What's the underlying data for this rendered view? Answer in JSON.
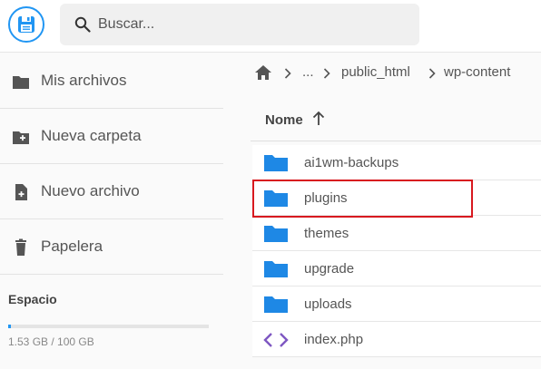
{
  "header": {
    "logo_icon": "floppy-disk-icon",
    "search_placeholder": "Buscar..."
  },
  "sidebar": {
    "items": [
      {
        "label": "Mis archivos",
        "icon": "folder-icon"
      },
      {
        "label": "Nueva carpeta",
        "icon": "folder-plus-icon"
      },
      {
        "label": "Nuevo archivo",
        "icon": "file-plus-icon"
      },
      {
        "label": "Papelera",
        "icon": "trash-icon"
      }
    ],
    "storage": {
      "title": "Espacio",
      "used_text": "1.53 GB / 100 GB",
      "used_fraction": 0.0153
    }
  },
  "breadcrumb": {
    "home_icon": "home-icon",
    "items": [
      "...",
      "public_html",
      "wp-content"
    ]
  },
  "table": {
    "column": "Nome",
    "sort_icon": "arrow-up-icon",
    "rows": [
      {
        "name": "ai1wm-backups",
        "type": "folder"
      },
      {
        "name": "plugins",
        "type": "folder",
        "highlighted": true
      },
      {
        "name": "themes",
        "type": "folder"
      },
      {
        "name": "upgrade",
        "type": "folder"
      },
      {
        "name": "uploads",
        "type": "folder"
      },
      {
        "name": "index.php",
        "type": "code-file"
      }
    ]
  },
  "colors": {
    "accent": "#2196f3",
    "folder": "#1e88e5",
    "code": "#7e57c2",
    "highlight_border": "#d8191f"
  }
}
